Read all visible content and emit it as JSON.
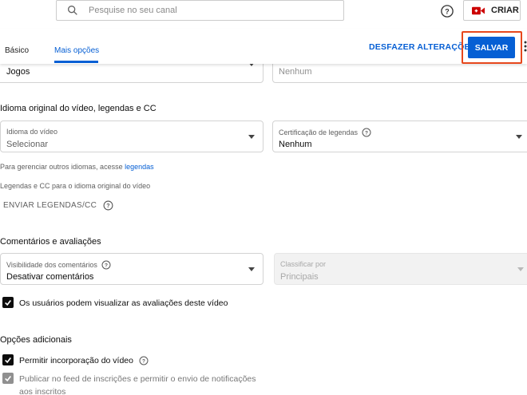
{
  "topbar": {
    "search_placeholder": "Pesquise no seu canal",
    "create_label": "CRIAR"
  },
  "tabs": {
    "basico": "Básico",
    "mais_opcoes": "Mais opções"
  },
  "actions": {
    "undo_label": "DESFAZER ALTERAÇÕES",
    "save_label": "SALVAR"
  },
  "top_fields": {
    "category_value": "Jogos",
    "license_value": "Nenhum"
  },
  "language_section": {
    "heading": "Idioma original do vídeo, legendas e CC",
    "video_language_label": "Idioma do vídeo",
    "video_language_value": "Selecionar",
    "caption_cert_label": "Certificação de legendas",
    "caption_cert_value": "Nenhum",
    "manage_text": "Para gerenciar outros idiomas, acesse",
    "manage_link": "legendas",
    "captions_note": "Legendas e CC para o idioma original do vídeo",
    "upload_captions": "ENVIAR LEGENDAS/CC"
  },
  "comments_section": {
    "heading": "Comentários e avaliações",
    "visibility_label": "Visibilidade dos comentários",
    "visibility_value": "Desativar comentários",
    "sort_label": "Classificar por",
    "sort_value": "Principais",
    "ratings_checkbox": "Os usuários podem visualizar as avaliações deste vídeo"
  },
  "additional_section": {
    "heading": "Opções adicionais",
    "embed_checkbox": "Permitir incorporação do vídeo",
    "publish_checkbox": "Publicar no feed de inscrições e permitir o envio de notificações aos inscritos"
  },
  "colors": {
    "accent": "#065fd4",
    "highlight": "#e7471c"
  }
}
